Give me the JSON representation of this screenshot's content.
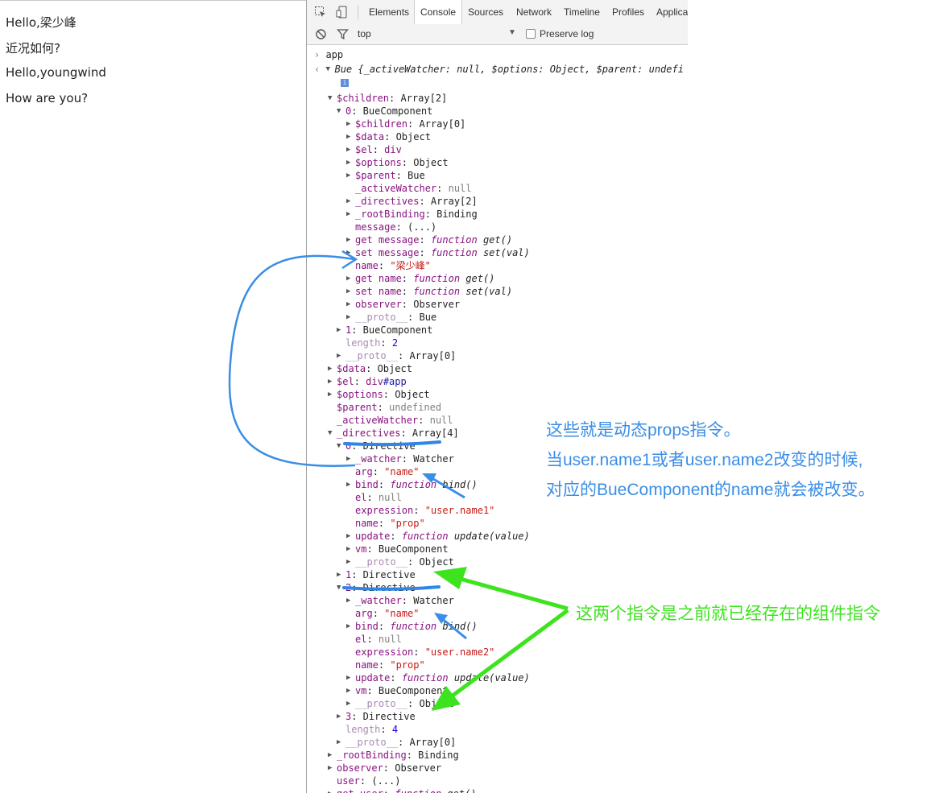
{
  "page": {
    "lines": [
      "Hello,梁少峰",
      "近况如何?",
      "Hello,youngwind",
      "How are you?"
    ]
  },
  "devtools": {
    "tabs": [
      "Elements",
      "Console",
      "Sources",
      "Network",
      "Timeline",
      "Profiles",
      "Applica"
    ],
    "active_tab": "Console",
    "toolbar_icons": [
      "inspect-icon",
      "device-mode-icon"
    ],
    "filter": {
      "context": "top",
      "preserve_log_label": "Preserve log",
      "preserve_log_checked": false,
      "icons": [
        "clear-console-icon",
        "filter-icon",
        "dropdown-arrow-icon"
      ]
    }
  },
  "console": {
    "input": "app",
    "result": "Bue {_activeWatcher: null, $options: Object, $parent: undefi",
    "info_badge": "i",
    "rows": [
      [
        {
          "c": "k",
          "t": "$children"
        },
        {
          "t": ": Array[2]"
        }
      ],
      [
        {
          "c": "k",
          "t": "0"
        },
        {
          "t": ": BueComponent"
        }
      ],
      [
        {
          "c": "k",
          "t": "$children"
        },
        {
          "t": ": Array[0]"
        }
      ],
      [
        {
          "c": "k",
          "t": "$data"
        },
        {
          "t": ": Object"
        }
      ],
      [
        {
          "c": "k",
          "t": "$el"
        },
        {
          "t": ": "
        },
        {
          "c": "k",
          "t": "div"
        }
      ],
      [
        {
          "c": "k",
          "t": "$options"
        },
        {
          "t": ": Object"
        }
      ],
      [
        {
          "c": "k",
          "t": "$parent"
        },
        {
          "t": ": Bue"
        }
      ],
      [
        {
          "c": "k",
          "t": "_activeWatcher"
        },
        {
          "t": ": "
        },
        {
          "c": "g",
          "t": "null"
        }
      ],
      [
        {
          "c": "k",
          "t": "_directives"
        },
        {
          "t": ": Array[2]"
        }
      ],
      [
        {
          "c": "k",
          "t": "_rootBinding"
        },
        {
          "t": ": Binding"
        }
      ],
      [
        {
          "c": "k",
          "t": "message"
        },
        {
          "t": ": (...)"
        }
      ],
      [
        {
          "c": "k",
          "t": "get message"
        },
        {
          "t": ": "
        },
        {
          "c": "f",
          "t": "function"
        },
        {
          "c": "it",
          "t": " get()"
        }
      ],
      [
        {
          "c": "k",
          "t": "set message"
        },
        {
          "t": ": "
        },
        {
          "c": "f",
          "t": "function"
        },
        {
          "c": "it",
          "t": " set(val)"
        }
      ],
      [
        {
          "c": "k",
          "t": "name"
        },
        {
          "t": ": "
        },
        {
          "c": "s",
          "t": "\"梁少峰\""
        }
      ],
      [
        {
          "c": "k",
          "t": "get name"
        },
        {
          "t": ": "
        },
        {
          "c": "f",
          "t": "function"
        },
        {
          "c": "it",
          "t": " get()"
        }
      ],
      [
        {
          "c": "k",
          "t": "set name"
        },
        {
          "t": ": "
        },
        {
          "c": "f",
          "t": "function"
        },
        {
          "c": "it",
          "t": " set(val)"
        }
      ],
      [
        {
          "c": "k",
          "t": "observer"
        },
        {
          "t": ": Observer"
        }
      ],
      [
        {
          "c": "ki",
          "t": "__proto__"
        },
        {
          "t": ": Bue"
        }
      ],
      [
        {
          "c": "k",
          "t": "1"
        },
        {
          "t": ": BueComponent"
        }
      ],
      [
        {
          "c": "ki",
          "t": "length"
        },
        {
          "t": ": "
        },
        {
          "c": "n",
          "t": "2"
        }
      ],
      [
        {
          "c": "ki",
          "t": "__proto__"
        },
        {
          "t": ": Array[0]"
        }
      ],
      [
        {
          "c": "k",
          "t": "$data"
        },
        {
          "t": ": Object"
        }
      ],
      [
        {
          "c": "k",
          "t": "$el"
        },
        {
          "t": ": "
        },
        {
          "c": "k",
          "t": "div"
        },
        {
          "c": "b",
          "t": "#app"
        }
      ],
      [
        {
          "c": "k",
          "t": "$options"
        },
        {
          "t": ": Object"
        }
      ],
      [
        {
          "c": "k",
          "t": "$parent"
        },
        {
          "t": ": "
        },
        {
          "c": "g",
          "t": "undefined"
        }
      ],
      [
        {
          "c": "k",
          "t": "_activeWatcher"
        },
        {
          "t": ": "
        },
        {
          "c": "g",
          "t": "null"
        }
      ],
      [
        {
          "c": "k",
          "t": "_directives"
        },
        {
          "t": ": Array[4]"
        }
      ],
      [
        {
          "c": "k",
          "t": "0"
        },
        {
          "t": ": Directive"
        }
      ],
      [
        {
          "c": "k",
          "t": "_watcher"
        },
        {
          "t": ": Watcher"
        }
      ],
      [
        {
          "c": "k",
          "t": "arg"
        },
        {
          "t": ": "
        },
        {
          "c": "s",
          "t": "\"name\""
        }
      ],
      [
        {
          "c": "k",
          "t": "bind"
        },
        {
          "t": ": "
        },
        {
          "c": "f",
          "t": "function"
        },
        {
          "c": "it",
          "t": " bind()"
        }
      ],
      [
        {
          "c": "k",
          "t": "el"
        },
        {
          "t": ": "
        },
        {
          "c": "g",
          "t": "null"
        }
      ],
      [
        {
          "c": "k",
          "t": "expression"
        },
        {
          "t": ": "
        },
        {
          "c": "s",
          "t": "\"user.name1\""
        }
      ],
      [
        {
          "c": "k",
          "t": "name"
        },
        {
          "t": ": "
        },
        {
          "c": "s",
          "t": "\"prop\""
        }
      ],
      [
        {
          "c": "k",
          "t": "update"
        },
        {
          "t": ": "
        },
        {
          "c": "f",
          "t": "function"
        },
        {
          "c": "it",
          "t": " update(value)"
        }
      ],
      [
        {
          "c": "k",
          "t": "vm"
        },
        {
          "t": ": BueComponent"
        }
      ],
      [
        {
          "c": "ki",
          "t": "__proto__"
        },
        {
          "t": ": Object"
        }
      ],
      [
        {
          "c": "k",
          "t": "1"
        },
        {
          "t": ": Directive"
        }
      ],
      [
        {
          "c": "k",
          "t": "2"
        },
        {
          "t": ": Directive"
        }
      ],
      [
        {
          "c": "k",
          "t": "_watcher"
        },
        {
          "t": ": Watcher"
        }
      ],
      [
        {
          "c": "k",
          "t": "arg"
        },
        {
          "t": ": "
        },
        {
          "c": "s",
          "t": "\"name\""
        }
      ],
      [
        {
          "c": "k",
          "t": "bind"
        },
        {
          "t": ": "
        },
        {
          "c": "f",
          "t": "function"
        },
        {
          "c": "it",
          "t": " bind()"
        }
      ],
      [
        {
          "c": "k",
          "t": "el"
        },
        {
          "t": ": "
        },
        {
          "c": "g",
          "t": "null"
        }
      ],
      [
        {
          "c": "k",
          "t": "expression"
        },
        {
          "t": ": "
        },
        {
          "c": "s",
          "t": "\"user.name2\""
        }
      ],
      [
        {
          "c": "k",
          "t": "name"
        },
        {
          "t": ": "
        },
        {
          "c": "s",
          "t": "\"prop\""
        }
      ],
      [
        {
          "c": "k",
          "t": "update"
        },
        {
          "t": ": "
        },
        {
          "c": "f",
          "t": "function"
        },
        {
          "c": "it",
          "t": " update(value)"
        }
      ],
      [
        {
          "c": "k",
          "t": "vm"
        },
        {
          "t": ": BueComponent"
        }
      ],
      [
        {
          "c": "ki",
          "t": "__proto__"
        },
        {
          "t": ": Object"
        }
      ],
      [
        {
          "c": "k",
          "t": "3"
        },
        {
          "t": ": Directive"
        }
      ],
      [
        {
          "c": "ki",
          "t": "length"
        },
        {
          "t": ": "
        },
        {
          "c": "n",
          "t": "4"
        }
      ],
      [
        {
          "c": "ki",
          "t": "__proto__"
        },
        {
          "t": ": Array[0]"
        }
      ],
      [
        {
          "c": "k",
          "t": "_rootBinding"
        },
        {
          "t": ": Binding"
        }
      ],
      [
        {
          "c": "k",
          "t": "observer"
        },
        {
          "t": ": Observer"
        }
      ],
      [
        {
          "c": "k",
          "t": "user"
        },
        {
          "t": ": (...)"
        }
      ],
      [
        {
          "c": "k",
          "t": "get user"
        },
        {
          "t": ": "
        },
        {
          "c": "f",
          "t": "function"
        },
        {
          "c": "it",
          "t": " get()"
        }
      ]
    ]
  },
  "annotations": {
    "blue_note": [
      "这些就是动态props指令。",
      "当user.name1或者user.name2改变的时候,",
      "对应的BueComponent的name就会被改变。"
    ],
    "green_note": "这两个指令是之前就已经存在的组件指令",
    "colors": {
      "blue": "#3a8ee6",
      "green": "#3ee31f"
    }
  }
}
